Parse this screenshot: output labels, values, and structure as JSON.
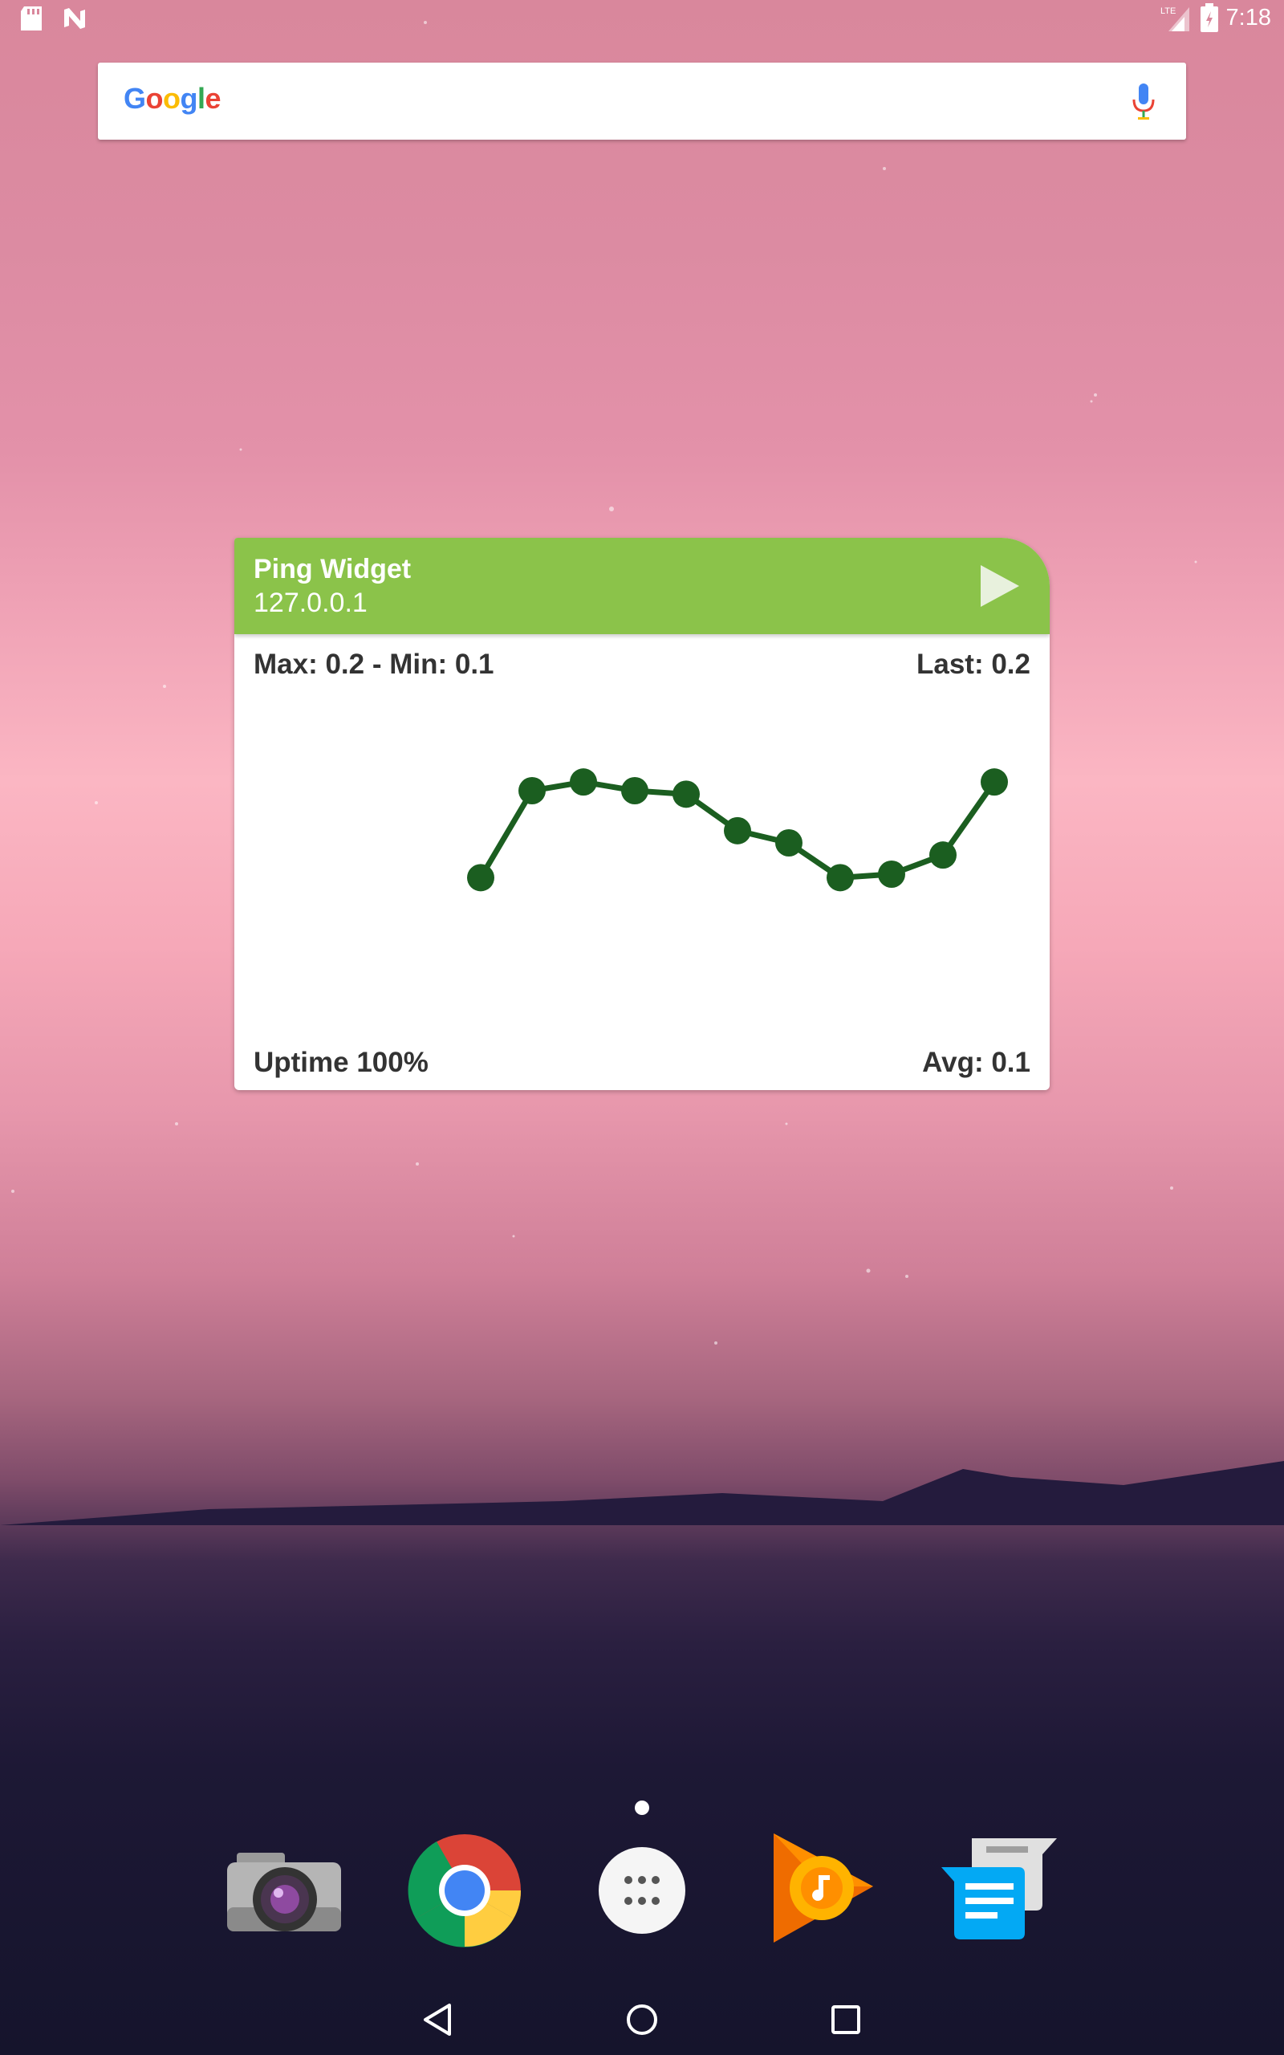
{
  "status_bar": {
    "time": "7:18",
    "network_label": "LTE",
    "icons": [
      "sd-card-icon",
      "n-notification-icon",
      "signal-icon",
      "battery-icon"
    ]
  },
  "search": {
    "logo_text": "Google",
    "logo_colors": [
      "#4285f4",
      "#ea4335",
      "#fbbc05",
      "#4285f4",
      "#34a853",
      "#ea4335"
    ],
    "icons": [
      "mic-icon"
    ]
  },
  "widget": {
    "title": "Ping Widget",
    "host": "127.0.0.1",
    "max_min": "Max: 0.2 - Min: 0.1",
    "last": "Last: 0.2",
    "uptime": "Uptime 100%",
    "avg": "Avg: 0.1",
    "accent_color": "#8bc34a",
    "line_color": "#1b5e20",
    "icons": [
      "play-icon"
    ]
  },
  "chart_data": {
    "type": "line",
    "x": [
      1,
      2,
      3,
      4,
      5,
      6,
      7,
      8,
      9,
      10,
      11
    ],
    "series": [
      {
        "values": [
          0.12,
          0.17,
          0.175,
          0.17,
          0.168,
          0.147,
          0.14,
          0.12,
          0.122,
          0.133,
          0.175
        ]
      }
    ],
    "title": "",
    "xlabel": "",
    "ylabel": "",
    "grid": false,
    "legend": false
  },
  "dock": {
    "apps": [
      {
        "name": "Camera",
        "icon": "camera-icon"
      },
      {
        "name": "Chrome",
        "icon": "chrome-icon"
      },
      {
        "name": "Apps",
        "icon": "app-drawer-icon"
      },
      {
        "name": "Play Music",
        "icon": "play-music-icon"
      },
      {
        "name": "Messages",
        "icon": "messages-icon"
      }
    ]
  },
  "nav": {
    "icons": [
      "back-icon",
      "home-icon",
      "recents-icon"
    ]
  }
}
